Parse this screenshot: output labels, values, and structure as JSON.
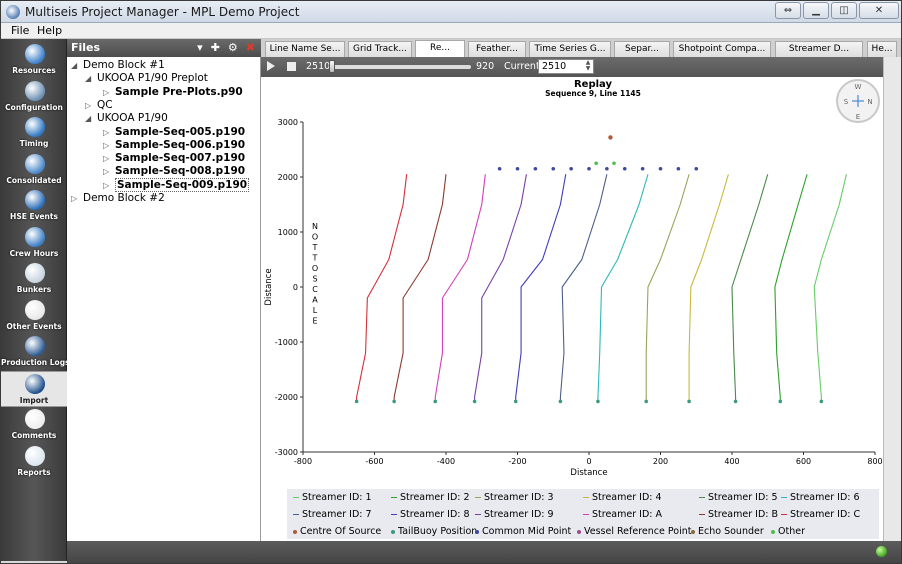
{
  "window": {
    "title": "Multiseis Project Manager - MPL Demo Project"
  },
  "menu": [
    "File",
    "Help"
  ],
  "nav": [
    {
      "label": "Resources",
      "icon": "resources-icon",
      "color": "#3a7fc8"
    },
    {
      "label": "Configuration",
      "icon": "configuration-icon",
      "color": "#6b8fb3"
    },
    {
      "label": "Timing",
      "icon": "timing-icon",
      "color": "#2f77c2"
    },
    {
      "label": "Consolidated",
      "icon": "consolidated-icon",
      "color": "#4a87c9"
    },
    {
      "label": "HSE Events",
      "icon": "hse-events-icon",
      "color": "#2b6cb8"
    },
    {
      "label": "Crew Hours",
      "icon": "crew-hours-icon",
      "color": "#3c7ec4"
    },
    {
      "label": "Bunkers",
      "icon": "bunkers-icon",
      "color": "#c7d3e0"
    },
    {
      "label": "Other Events",
      "icon": "other-events-icon",
      "color": "#e8e8e8"
    },
    {
      "label": "Production Logs",
      "icon": "production-logs-icon",
      "color": "#2f5e96"
    },
    {
      "label": "Import",
      "icon": "import-icon",
      "color": "#1f4f8a"
    },
    {
      "label": "Comments",
      "icon": "comments-icon",
      "color": "#eeeeee"
    },
    {
      "label": "Reports",
      "icon": "reports-icon",
      "color": "#dde6ef"
    }
  ],
  "files": {
    "title": "Files",
    "tree": [
      {
        "label": "Demo Block #1",
        "depth": 0,
        "arrow": "◢",
        "bold": false
      },
      {
        "label": "UKOOA P1/90 Preplot",
        "depth": 1,
        "arrow": "◢",
        "bold": false
      },
      {
        "label": "Sample Pre-Plots.p90",
        "depth": 2,
        "arrow": "▷",
        "bold": true
      },
      {
        "label": "QC",
        "depth": 1,
        "arrow": "▷",
        "bold": false
      },
      {
        "label": "UKOOA P1/90",
        "depth": 1,
        "arrow": "◢",
        "bold": false
      },
      {
        "label": "Sample-Seq-005.p190",
        "depth": 2,
        "arrow": "▷",
        "bold": true
      },
      {
        "label": "Sample-Seq-006.p190",
        "depth": 2,
        "arrow": "▷",
        "bold": true
      },
      {
        "label": "Sample-Seq-007.p190",
        "depth": 2,
        "arrow": "▷",
        "bold": true
      },
      {
        "label": "Sample-Seq-008.p190",
        "depth": 2,
        "arrow": "▷",
        "bold": true
      },
      {
        "label": "Sample-Seq-009.p190",
        "depth": 2,
        "arrow": "▷",
        "bold": true,
        "selected": true
      },
      {
        "label": "Demo Block #2",
        "depth": 0,
        "arrow": "▷",
        "bold": false
      }
    ]
  },
  "tabs": [
    "Line Name Se...",
    "Grid Track...",
    "Re...",
    "Feather...",
    "Time Series G...",
    "Separ...",
    "Shotpoint Compa...",
    "Streamer D...",
    "He..."
  ],
  "active_tab": 2,
  "toolbar": {
    "min": "2510",
    "max": "920",
    "current_label": "Current:",
    "current_value": "2510"
  },
  "replay_progress": 0.0,
  "compass": {
    "n": "N",
    "s": "S",
    "e": "E",
    "w": "W"
  },
  "status_color": "#3fa320",
  "chart_data": {
    "type": "scatter",
    "title": "Replay",
    "subtitle": "Sequence 9, Line 1145",
    "xlabel": "Distance",
    "ylabel": "Distance",
    "annotation": "NOT TO SCALE",
    "xlim": [
      -800,
      800
    ],
    "ylim": [
      -3000,
      3000
    ],
    "xticks": [
      -800,
      -600,
      -400,
      -200,
      0,
      200,
      400,
      600,
      800
    ],
    "yticks": [
      -3000,
      -2000,
      -1000,
      0,
      1000,
      2000,
      3000
    ],
    "legend": [
      {
        "name": "Streamer ID: 1",
        "color": "#66cc66",
        "kind": "line"
      },
      {
        "name": "Streamer ID: 2",
        "color": "#2ca02c",
        "kind": "line"
      },
      {
        "name": "Streamer ID: 3",
        "color": "#9aa35a",
        "kind": "line"
      },
      {
        "name": "Streamer ID: 4",
        "color": "#c8b93e",
        "kind": "line"
      },
      {
        "name": "Streamer ID: 5",
        "color": "#4a8a4a",
        "kind": "line"
      },
      {
        "name": "Streamer ID: 6",
        "color": "#2fb7b7",
        "kind": "line"
      },
      {
        "name": "Streamer ID: 7",
        "color": "#4c5f8a",
        "kind": "line"
      },
      {
        "name": "Streamer ID: 8",
        "color": "#3d3dbd",
        "kind": "line"
      },
      {
        "name": "Streamer ID: 9",
        "color": "#7a3fa3",
        "kind": "line"
      },
      {
        "name": "Streamer ID: A",
        "color": "#d43fb5",
        "kind": "line"
      },
      {
        "name": "Streamer ID: B",
        "color": "#8a3a2e",
        "kind": "line"
      },
      {
        "name": "Streamer ID: C",
        "color": "#d62f3a",
        "kind": "line"
      },
      {
        "name": "Centre Of Source",
        "color": "#b05a3a",
        "kind": "dot"
      },
      {
        "name": "TailBuoy Position",
        "color": "#3a9a7a",
        "kind": "dot"
      },
      {
        "name": "Common Mid Point",
        "color": "#3a4aa0",
        "kind": "dot"
      },
      {
        "name": "Vessel Reference Point",
        "color": "#a04a8a",
        "kind": "dot"
      },
      {
        "name": "Echo Sounder",
        "color": "#8a6a3a",
        "kind": "dot"
      },
      {
        "name": "Other",
        "color": "#4ac04a",
        "kind": "dot"
      }
    ],
    "streamers": [
      {
        "id": "C",
        "color": "#d62f3a",
        "head": [
          -510,
          2050
        ],
        "tail": [
          -650,
          -2080
        ],
        "bend": [
          [
            -520,
            1500
          ],
          [
            -560,
            500
          ],
          [
            -620,
            -200
          ],
          [
            -625,
            -1200
          ],
          [
            -650,
            -2000
          ]
        ]
      },
      {
        "id": "B",
        "color": "#8a3a2e",
        "head": [
          -400,
          2050
        ],
        "tail": [
          -545,
          -2080
        ],
        "bend": [
          [
            -410,
            1500
          ],
          [
            -450,
            500
          ],
          [
            -520,
            -200
          ],
          [
            -520,
            -1200
          ],
          [
            -545,
            -2000
          ]
        ]
      },
      {
        "id": "A",
        "color": "#d43fb5",
        "head": [
          -290,
          2050
        ],
        "tail": [
          -430,
          -2080
        ],
        "bend": [
          [
            -300,
            1500
          ],
          [
            -340,
            500
          ],
          [
            -410,
            -200
          ],
          [
            -410,
            -1200
          ],
          [
            -430,
            -2000
          ]
        ]
      },
      {
        "id": "9",
        "color": "#7a3fa3",
        "head": [
          -175,
          2050
        ],
        "tail": [
          -320,
          -2080
        ],
        "bend": [
          [
            -190,
            1500
          ],
          [
            -240,
            500
          ],
          [
            -300,
            -200
          ],
          [
            -300,
            -1200
          ],
          [
            -320,
            -2000
          ]
        ]
      },
      {
        "id": "8",
        "color": "#3d3dbd",
        "head": [
          -65,
          2050
        ],
        "tail": [
          -205,
          -2080
        ],
        "bend": [
          [
            -80,
            1500
          ],
          [
            -130,
            500
          ],
          [
            -190,
            0
          ],
          [
            -190,
            -1200
          ],
          [
            -205,
            -2000
          ]
        ]
      },
      {
        "id": "7",
        "color": "#4c5f8a",
        "head": [
          50,
          2050
        ],
        "tail": [
          -80,
          -2080
        ],
        "bend": [
          [
            30,
            1500
          ],
          [
            -20,
            500
          ],
          [
            -75,
            0
          ],
          [
            -70,
            -1200
          ],
          [
            -80,
            -2000
          ]
        ]
      },
      {
        "id": "6",
        "color": "#2fb7b7",
        "head": [
          165,
          2050
        ],
        "tail": [
          25,
          -2080
        ],
        "bend": [
          [
            140,
            1500
          ],
          [
            80,
            500
          ],
          [
            35,
            0
          ],
          [
            30,
            -1200
          ],
          [
            25,
            -2000
          ]
        ]
      },
      {
        "id": "5",
        "color": "#9aa35a",
        "head": [
          280,
          2050
        ],
        "tail": [
          160,
          -2080
        ],
        "bend": [
          [
            255,
            1500
          ],
          [
            200,
            500
          ],
          [
            165,
            0
          ],
          [
            160,
            -1200
          ],
          [
            160,
            -2000
          ]
        ]
      },
      {
        "id": "4",
        "color": "#c8b93e",
        "head": [
          390,
          2050
        ],
        "tail": [
          280,
          -2080
        ],
        "bend": [
          [
            365,
            1500
          ],
          [
            315,
            500
          ],
          [
            285,
            0
          ],
          [
            280,
            -1200
          ],
          [
            280,
            -2000
          ]
        ]
      },
      {
        "id": "3",
        "color": "#4a8a4a",
        "head": [
          500,
          2050
        ],
        "tail": [
          410,
          -2080
        ],
        "bend": [
          [
            475,
            1500
          ],
          [
            425,
            500
          ],
          [
            400,
            0
          ],
          [
            405,
            -1200
          ],
          [
            410,
            -2000
          ]
        ]
      },
      {
        "id": "2",
        "color": "#2ca02c",
        "head": [
          610,
          2050
        ],
        "tail": [
          535,
          -2080
        ],
        "bend": [
          [
            585,
            1500
          ],
          [
            540,
            500
          ],
          [
            520,
            0
          ],
          [
            525,
            -1200
          ],
          [
            535,
            -2000
          ]
        ]
      },
      {
        "id": "1",
        "color": "#66cc66",
        "head": [
          720,
          2050
        ],
        "tail": [
          650,
          -2080
        ],
        "bend": [
          [
            700,
            1500
          ],
          [
            650,
            500
          ],
          [
            630,
            0
          ],
          [
            640,
            -1200
          ],
          [
            650,
            -2000
          ]
        ]
      }
    ],
    "cmp_points": [
      [
        -250,
        2150
      ],
      [
        -200,
        2150
      ],
      [
        -150,
        2150
      ],
      [
        -100,
        2150
      ],
      [
        -50,
        2150
      ],
      [
        0,
        2150
      ],
      [
        50,
        2150
      ],
      [
        100,
        2150
      ],
      [
        150,
        2150
      ],
      [
        200,
        2150
      ],
      [
        250,
        2150
      ],
      [
        300,
        2150
      ]
    ],
    "source_points": [
      [
        20,
        2250
      ],
      [
        70,
        2250
      ]
    ],
    "vessel_point": [
      60,
      2720
    ]
  }
}
